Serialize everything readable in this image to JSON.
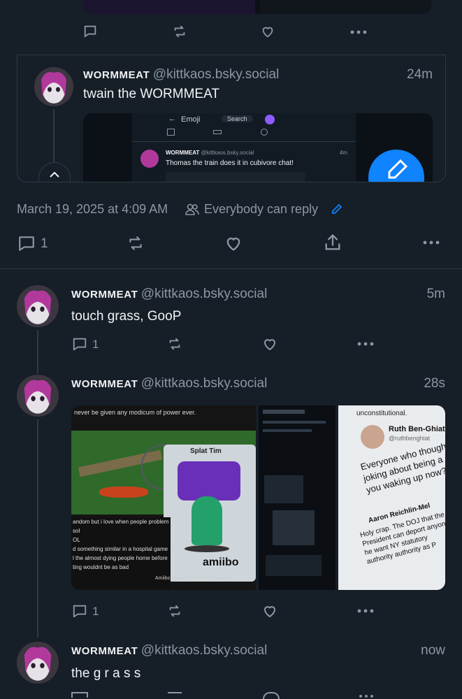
{
  "top_actions": {
    "reply": "",
    "repost": "",
    "like": "",
    "more": ""
  },
  "quoted": {
    "display_name": "WORMMEAT",
    "handle": "@kittkaos.bsky.social",
    "time": "24m",
    "text": "twain the WORMMEAT",
    "inner": {
      "back_label": "Emoji",
      "search_placeholder": "Search",
      "display_name": "WORMMEAT",
      "handle": "@kittkaos.bsky.social",
      "time": "4m",
      "text": "Thomas the train does it in cubivore chat!"
    }
  },
  "main_meta": {
    "date": "March 19, 2025 at 4:09 AM",
    "reply_setting": "Everybody can reply",
    "reply_count": "1"
  },
  "replies": [
    {
      "display_name": "WORMMEAT",
      "handle": "@kittkaos.bsky.social",
      "time": "5m",
      "text": "touch grass, GooP",
      "reply_count": "1"
    },
    {
      "display_name": "WORMMEAT",
      "handle": "@kittkaos.bsky.social",
      "time": "28s",
      "text": "",
      "reply_count": "1",
      "image_texts": {
        "left_top": "never be given any modicum of power ever.",
        "left_caption_1": "andom but i love when people problem sol",
        "left_caption_2": "OL",
        "left_caption_3": "d something similar in a hospital game",
        "left_caption_4": "l the almost dying people home before",
        "left_caption_5": "ting wouldnt be as bad",
        "amiibo_label": "amiibo",
        "splat_label": "Splat Tim",
        "amiibo_caption": "Amiibo | Splat Tim Wikia | Fandom",
        "right_top": "unconstitutional.",
        "right_name": "Ruth Ben-Ghiat",
        "right_handle": "@ruthbenghiat",
        "right_quote": "Everyone who thought joking about being a di you waking up now?",
        "right_name2": "Aaron Reichlin-Mel",
        "right_text2": "Holy crap. The DOJ that the President can deport anyone he want NY statutory authority authority as P"
      }
    },
    {
      "display_name": "WORMMEAT",
      "handle": "@kittkaos.bsky.social",
      "time": "now",
      "text": "the g r a s s"
    }
  ],
  "colors": {
    "bg": "#161e27",
    "accent": "#1083fe",
    "muted": "#8b98a5"
  }
}
